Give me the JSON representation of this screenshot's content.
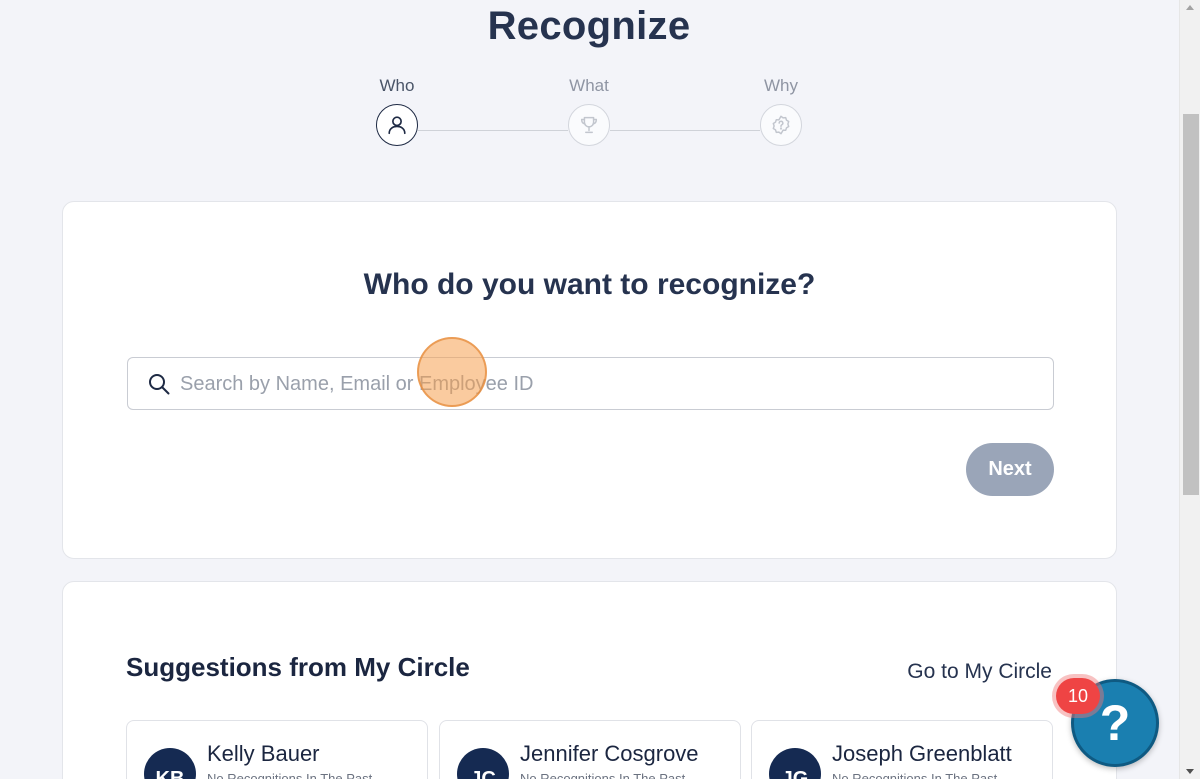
{
  "page": {
    "title": "Recognize"
  },
  "stepper": {
    "steps": [
      {
        "label": "Who",
        "icon": "user-icon",
        "active": true
      },
      {
        "label": "What",
        "icon": "trophy-icon",
        "active": false
      },
      {
        "label": "Why",
        "icon": "badge-question-icon",
        "active": false
      }
    ]
  },
  "main": {
    "heading": "Who do you want to recognize?",
    "search": {
      "placeholder": "Search by Name, Email or Employee ID",
      "value": ""
    },
    "next_label": "Next"
  },
  "suggestions": {
    "heading": "Suggestions from My Circle",
    "link_label": "Go to My Circle",
    "people": [
      {
        "initials": "KB",
        "name": "Kelly Bauer",
        "subtitle": "No Recognitions In The Past"
      },
      {
        "initials": "JC",
        "name": "Jennifer Cosgrove",
        "subtitle": "No Recognitions In The Past"
      },
      {
        "initials": "JG",
        "name": "Joseph Greenblatt",
        "subtitle": "No Recognitions In The Past"
      }
    ]
  },
  "help": {
    "badge_count": "10",
    "icon_label": "?"
  },
  "colors": {
    "primary_text": "#26334f",
    "next_button": "#9aa5b8",
    "avatar": "#152a52",
    "help_button": "#1a7fb0",
    "badge": "#ef4444"
  }
}
